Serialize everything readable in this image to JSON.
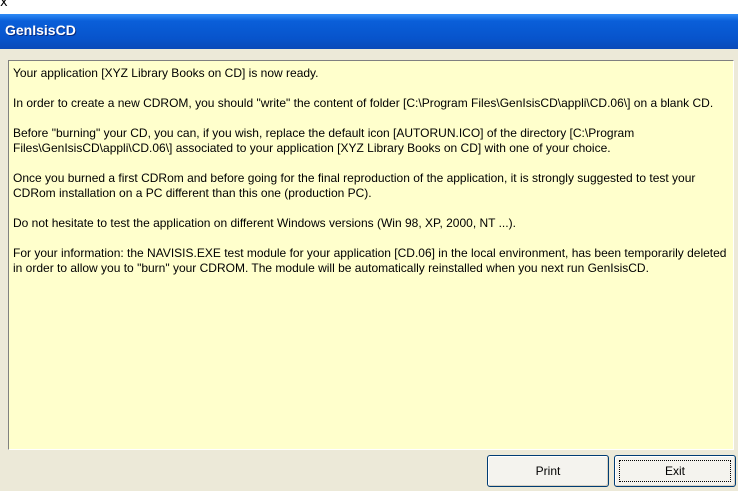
{
  "window": {
    "close_glyph": "x",
    "title": "GenIsisCD"
  },
  "message": {
    "paragraphs": [
      "Your application [XYZ Library Books on CD] is now ready.",
      "In order to create a new CDROM, you should \"write\" the content of folder [C:\\Program Files\\GenIsisCD\\appli\\CD.06\\] on a blank CD.",
      "Before \"burning\" your CD, you can, if you wish, replace the default icon [AUTORUN.ICO] of the directory [C:\\Program Files\\GenIsisCD\\appli\\CD.06\\] associated to your application [XYZ Library Books on CD] with one of your choice.",
      "Once you burned a first CDRom and before going for the final reproduction of the application, it is strongly suggested to test your CDRom installation on a PC different than this one (production PC).",
      "Do not hesitate to test the application on different Windows versions (Win 98, XP, 2000, NT ...).",
      "For your information: the NAVISIS.EXE test module for your application [CD.06] in the local environment, has been temporarily deleted in order to allow you to \"burn\" your CDROM. The module will be automatically reinstalled when you next run GenIsisCD."
    ]
  },
  "buttons": {
    "print_label": "Print",
    "exit_label": "Exit"
  }
}
